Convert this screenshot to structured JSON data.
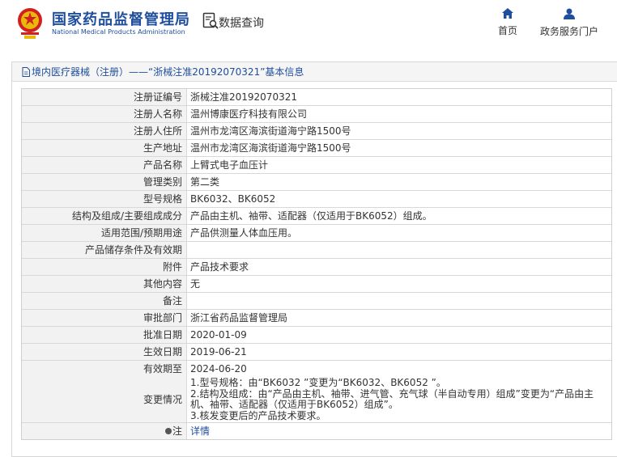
{
  "header": {
    "site_name_cn": "国家药品监督管理局",
    "site_name_en": "National Medical Products Administration",
    "query_label": "数据查询",
    "nav": [
      {
        "label": "首页",
        "icon": "home-icon"
      },
      {
        "label": "政务服务门户",
        "icon": "user-icon"
      }
    ]
  },
  "panel": {
    "title": "境内医疗器械（注册）——“浙械注准20192070321”基本信息"
  },
  "rows": [
    {
      "label": "注册证编号",
      "value": "浙械注准20192070321"
    },
    {
      "label": "注册人名称",
      "value": "温州博康医疗科技有限公司"
    },
    {
      "label": "注册人住所",
      "value": "温州市龙湾区海滨街道海宁路1500号"
    },
    {
      "label": "生产地址",
      "value": "温州市龙湾区海滨街道海宁路1500号"
    },
    {
      "label": "产品名称",
      "value": "上臂式电子血压计"
    },
    {
      "label": "管理类别",
      "value": "第二类"
    },
    {
      "label": "型号规格",
      "value": "BK6032、BK6052"
    },
    {
      "label": "结构及组成/主要组成成分",
      "value": "产品由主机、袖带、适配器（仅适用于BK6052）组成。"
    },
    {
      "label": "适用范围/预期用途",
      "value": "产品供测量人体血压用。"
    },
    {
      "label": "产品储存条件及有效期",
      "value": ""
    },
    {
      "label": "附件",
      "value": "产品技术要求"
    },
    {
      "label": "其他内容",
      "value": "无"
    },
    {
      "label": "备注",
      "value": ""
    },
    {
      "label": "审批部门",
      "value": "浙江省药品监督管理局"
    },
    {
      "label": "批准日期",
      "value": "2020-01-09"
    },
    {
      "label": "生效日期",
      "value": "2019-06-21"
    },
    {
      "label": "有效期至",
      "value": "2024-06-20"
    }
  ],
  "change": {
    "label": "变更情况",
    "lines": [
      "1.型号规格：由“BK6032 ”变更为“BK6032、BK6052 ”。",
      "2.结构及组成：由“产品由主机、袖带、进气管、充气球（半自动专用）组成”变更为“产品由主机、袖带、适配器（仅适用于BK6052）组成”。",
      "3.核发变更后的产品技术要求。"
    ]
  },
  "note": {
    "label": "注",
    "link": "详情"
  }
}
